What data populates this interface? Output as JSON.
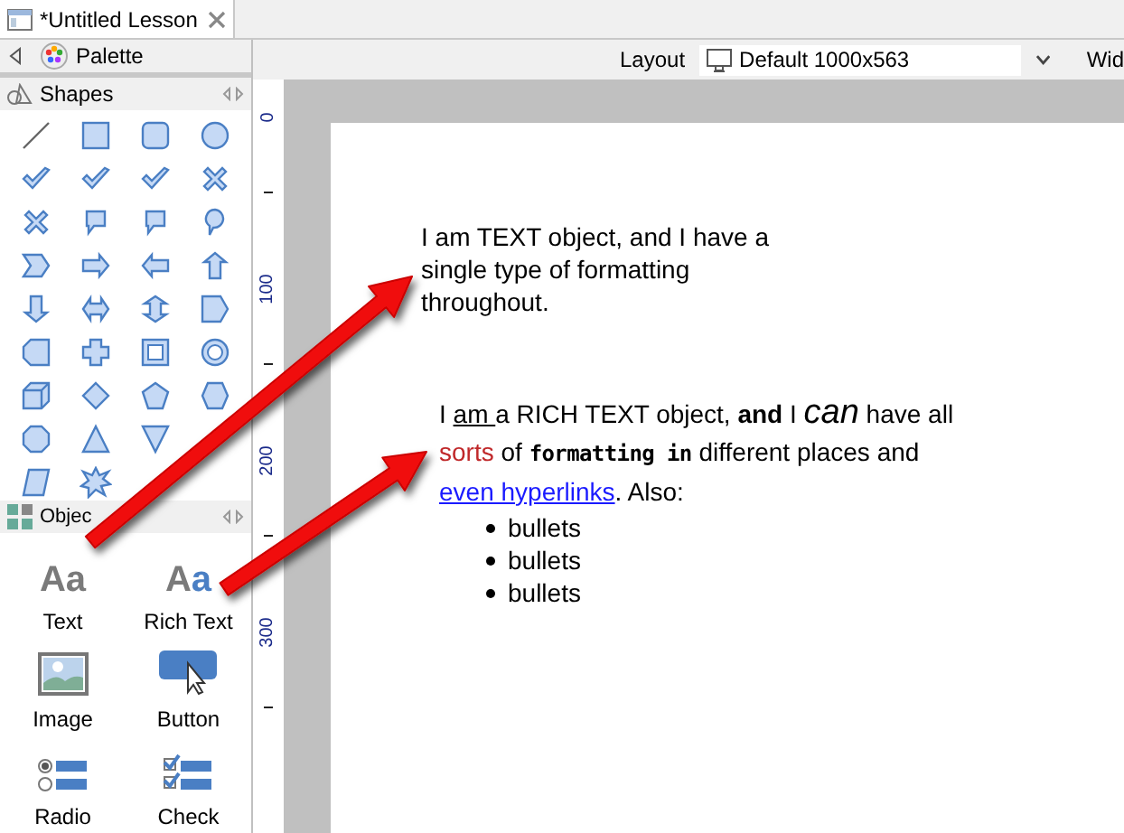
{
  "tab": {
    "title": "*Untitled Lesson"
  },
  "palette": {
    "title": "Palette",
    "shapes": {
      "title": "Shapes"
    },
    "objects": {
      "title": "Objec",
      "items": [
        {
          "label": "Text",
          "kind": "text",
          "icon_text": "Aa"
        },
        {
          "label": "Rich Text",
          "kind": "rich",
          "icon_text": "Aa"
        },
        {
          "label": "Image",
          "kind": "image"
        },
        {
          "label": "Button",
          "kind": "button"
        },
        {
          "label": "Radio",
          "kind": "radio"
        },
        {
          "label": "Check",
          "kind": "check"
        }
      ]
    }
  },
  "toolbar": {
    "layout_label": "Layout",
    "layout_value": "Default 1000x563",
    "next_label": "Wid"
  },
  "ruler": {
    "labels": [
      "0",
      "100",
      "200",
      "300"
    ]
  },
  "text_object": {
    "text": "I am TEXT object, and I have a single type of formatting throughout."
  },
  "rich_text_object": {
    "segments": [
      {
        "text": "I ",
        "kind": "plain"
      },
      {
        "text": "am ",
        "kind": "underline"
      },
      {
        "text": "a RICH TEXT object, ",
        "kind": "plain"
      },
      {
        "text": "and",
        "kind": "bold"
      },
      {
        "text": " I ",
        "kind": "plain"
      },
      {
        "text": "can",
        "kind": "italic-large"
      },
      {
        "text": " have all ",
        "kind": "plain"
      },
      {
        "text": "sorts",
        "kind": "red"
      },
      {
        "text": " of ",
        "kind": "plain"
      },
      {
        "text": "formatting in",
        "kind": "comic"
      },
      {
        "text": " different places and ",
        "kind": "plain"
      },
      {
        "text": "even hyperlinks",
        "kind": "link"
      },
      {
        "text": ".  Also:",
        "kind": "plain"
      }
    ],
    "bullets": [
      "bullets",
      "bullets",
      "bullets"
    ]
  }
}
